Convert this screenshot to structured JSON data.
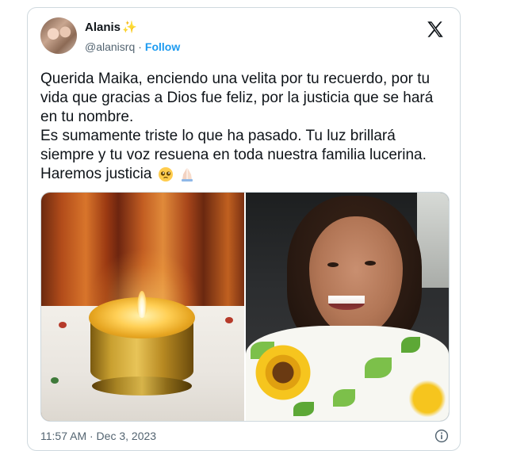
{
  "tweet": {
    "author": {
      "display_name": "Alanis",
      "handle": "@alanisrq",
      "separator": "·",
      "follow_label": "Follow"
    },
    "text_paragraphs": [
      "Querida Maika, enciendo una velita por tu recuerdo, por tu vida que gracias a Dios fue feliz, por la justicia que se hará en tu nombre.",
      "Es sumamente triste lo que ha pasado. Tu luz brillará siempre y tu voz resuena en toda nuestra familia lucerina.",
      "Haremos justicia"
    ],
    "emojis": [
      "pleading-face",
      "folded-hands"
    ],
    "media": [
      {
        "description_icon": "candle-photo"
      },
      {
        "description_icon": "woman-selfie-photo"
      }
    ],
    "timestamp": "11:57 AM · Dec 3, 2023"
  },
  "colors": {
    "link": "#1d9bf0",
    "text": "#0f1419",
    "secondary_text": "#536471",
    "border": "#cfd9de",
    "sparkle": "#f5c518"
  },
  "icons": {
    "sparkle": "sparkle-icon",
    "brand": "x-logo-icon",
    "info": "info-icon"
  }
}
